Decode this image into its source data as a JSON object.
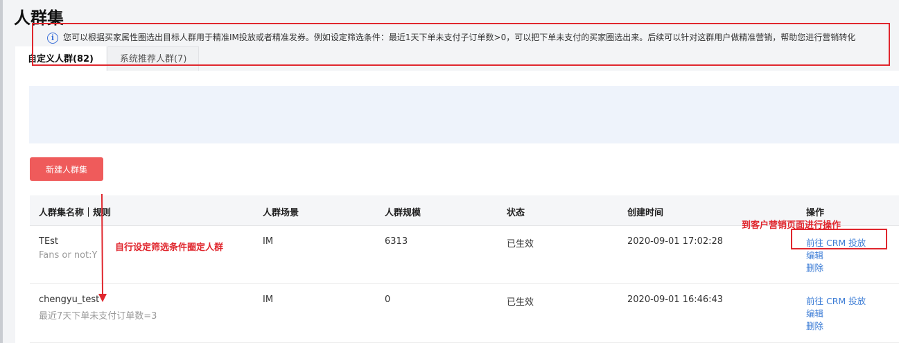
{
  "page": {
    "title": "人群集"
  },
  "tabs": [
    {
      "label": "自定义人群(82)",
      "active": true
    },
    {
      "label": "系统推荐人群(7)",
      "active": false
    }
  ],
  "notice": {
    "icon": "info-icon",
    "text": "您可以根据买家属性圈选出目标人群用于精准IM投放或者精准发券。例如设定筛选条件：最近1天下单未支付子订单数>0，可以把下单未支付的买家圈选出来。后续可以针对这群用户做精准营销，帮助您进行营销转化"
  },
  "toolbar": {
    "new_button": "新建人群集"
  },
  "table": {
    "columns": [
      "人群集名称｜规则",
      "人群场景",
      "人群规模",
      "状态",
      "创建时间",
      "操作"
    ],
    "rows": [
      {
        "name": "TEst",
        "rule": "Fans or not:Y",
        "scene": "IM",
        "size": "6313",
        "status": "已生效",
        "created": "2020-09-01 17:02:28",
        "actions": [
          "前往 CRM 投放",
          "编辑",
          "删除"
        ]
      },
      {
        "name": "chengyu_test",
        "rule": "最近7天下单未支付订单数=3",
        "scene": "IM",
        "size": "0",
        "status": "已生效",
        "created": "2020-09-01 16:46:43",
        "actions": [
          "前往 CRM 投放",
          "编辑",
          "删除"
        ]
      }
    ]
  },
  "annotations": {
    "rule_note": "自行设定筛选条件圈定人群",
    "action_note": "到客户营销页面进行操作",
    "color": "#e0262d"
  },
  "colors": {
    "primary_button": "#ef5b5b",
    "link": "#3a7bd5",
    "notice_bg": "#eef3fb"
  }
}
